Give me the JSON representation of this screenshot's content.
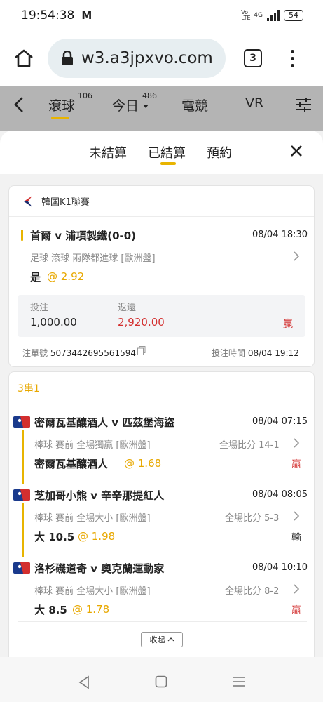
{
  "status_bar": {
    "time": "19:54:38",
    "carrier_icon": "M",
    "network": "4G",
    "volte": "Vo LTE",
    "battery": "54"
  },
  "browser": {
    "url": "w3.a3jpxvo.com",
    "tab_count": "3"
  },
  "app_nav": {
    "tabs": [
      {
        "label": "滾球",
        "badge": "106",
        "active": true
      },
      {
        "label": "今日",
        "badge": "486",
        "active": false
      },
      {
        "label": "電競",
        "badge": "",
        "active": false
      },
      {
        "label": "VR",
        "badge": "",
        "active": false
      }
    ]
  },
  "sheet": {
    "tabs": [
      {
        "label": "未結算",
        "active": false
      },
      {
        "label": "已結算",
        "active": true
      },
      {
        "label": "預約",
        "active": false
      }
    ]
  },
  "single_bet": {
    "league": "韓國K1聯賽",
    "match": "首爾 v 浦項製鐵(0-0)",
    "match_time": "08/04 18:30",
    "description": "足球 滾球   兩隊都進球 [歐洲盤]",
    "pick": "是",
    "odds": "@ 2.92",
    "stake_label": "投注",
    "stake": "1,000.00",
    "return_label": "返還",
    "return": "2,920.00",
    "result": "贏",
    "ticket_label": "注單號",
    "ticket_no": "5073442695561594",
    "bet_time_label": "投注時間",
    "bet_time": "08/04 19:12"
  },
  "parlay": {
    "title": "3串1",
    "legs": [
      {
        "match": "密爾瓦基釀酒人 v 匹茲堡海盜",
        "time": "08/04 07:15",
        "description": "棒球 賽前   全場獨贏 [歐洲盤]",
        "score": "全場比分 14-1",
        "pick": "密爾瓦基釀酒人",
        "odds": "@ 1.68",
        "result": "贏"
      },
      {
        "match": "芝加哥小熊 v 辛辛那提紅人",
        "time": "08/04 08:05",
        "description": "棒球 賽前   全場大小 [歐洲盤]",
        "score": "全場比分 5-3",
        "pick": "大 10.5",
        "odds": "@ 1.98",
        "result": "輸"
      },
      {
        "match": "洛杉磯道奇 v 奧克蘭運動家",
        "time": "08/04 10:10",
        "description": "棒球 賽前   全場大小 [歐洲盤]",
        "score": "全場比分 8-2",
        "pick": "大 8.5",
        "odds": "@ 1.78",
        "result": "贏"
      }
    ],
    "collapse_label": "收起"
  },
  "colors": {
    "accent": "#e8b400",
    "win": "#d32f2f",
    "nav_bg": "#b4b4b4"
  }
}
